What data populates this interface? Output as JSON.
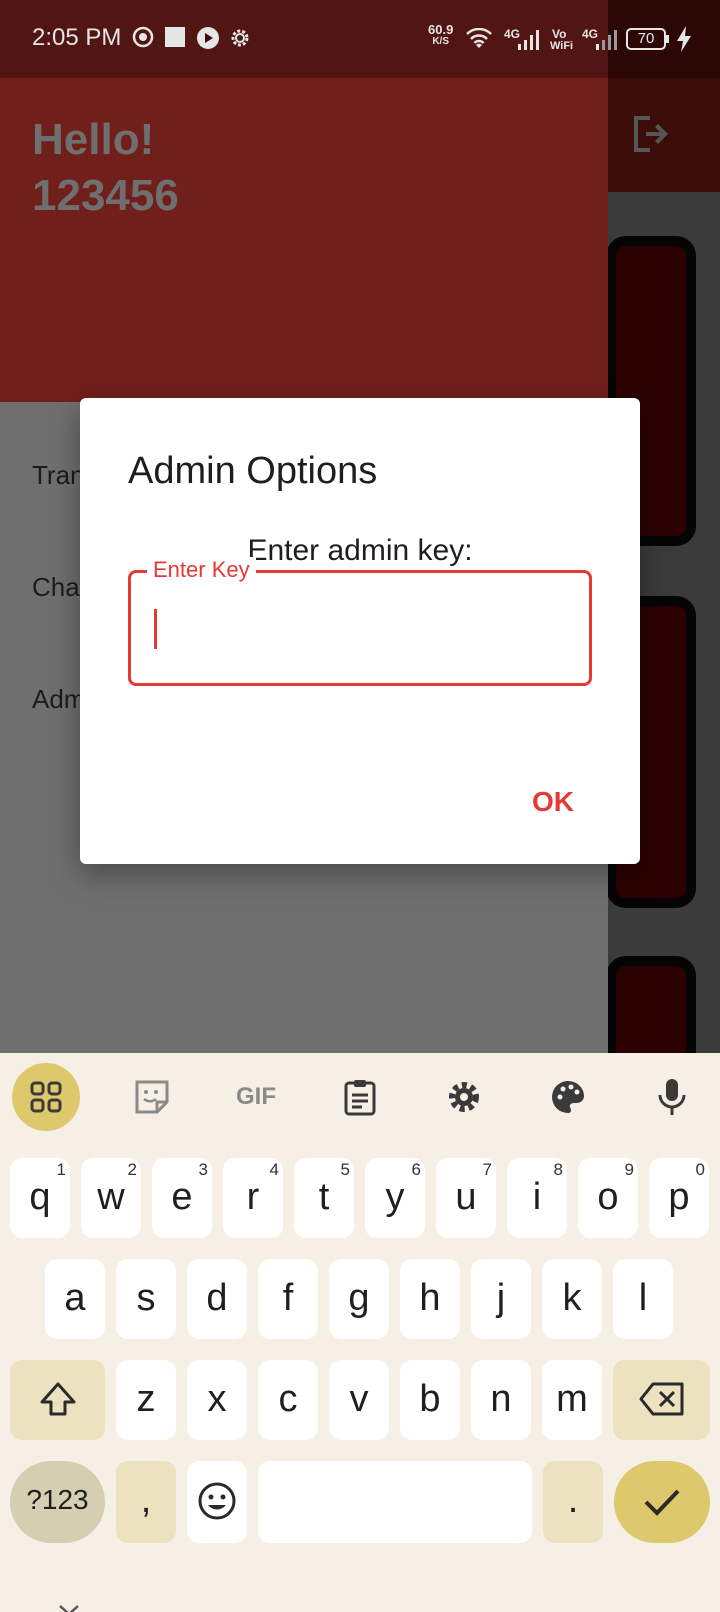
{
  "status_bar": {
    "time": "2:05 PM",
    "net_speed_value": "60.9",
    "net_speed_unit": "K/S",
    "sim1_label": "4G",
    "volte_label_top": "Vo",
    "volte_label_bottom": "WiFi",
    "sim2_label": "4G",
    "battery_level": "70"
  },
  "drawer": {
    "greeting_line1": "Hello!",
    "greeting_line2": "123456",
    "items": [
      {
        "label": "Tran"
      },
      {
        "label": "Cha"
      },
      {
        "label": "Adm"
      }
    ]
  },
  "dialog": {
    "title": "Admin Options",
    "message": "Enter admin key:",
    "field_label": "Enter Key",
    "field_value": "",
    "ok_label": "OK"
  },
  "keyboard": {
    "row1": [
      {
        "key": "q",
        "hint": "1"
      },
      {
        "key": "w",
        "hint": "2"
      },
      {
        "key": "e",
        "hint": "3"
      },
      {
        "key": "r",
        "hint": "4"
      },
      {
        "key": "t",
        "hint": "5"
      },
      {
        "key": "y",
        "hint": "6"
      },
      {
        "key": "u",
        "hint": "7"
      },
      {
        "key": "i",
        "hint": "8"
      },
      {
        "key": "o",
        "hint": "9"
      },
      {
        "key": "p",
        "hint": "0"
      }
    ],
    "row2": [
      "a",
      "s",
      "d",
      "f",
      "g",
      "h",
      "j",
      "k",
      "l"
    ],
    "row3": [
      "z",
      "x",
      "c",
      "v",
      "b",
      "n",
      "m"
    ],
    "symbols_label": "?123",
    "comma_label": ",",
    "period_label": ".",
    "gif_label": "GIF"
  },
  "colors": {
    "accent_red": "#e53935",
    "drawer_header": "#711f1b",
    "keyboard_bg": "#f5efe6",
    "keyboard_accent": "#ddc86b"
  }
}
